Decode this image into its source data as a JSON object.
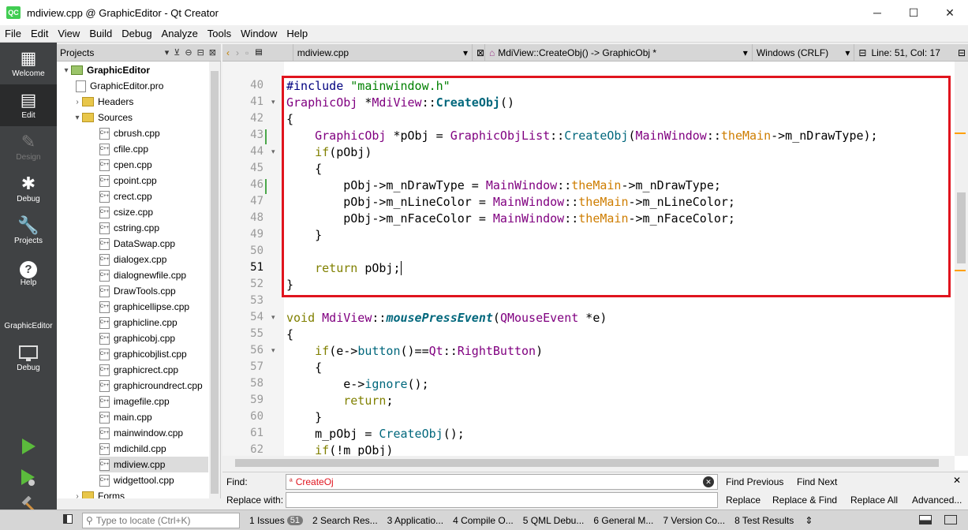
{
  "window": {
    "title": "mdiview.cpp @ GraphicEditor - Qt Creator",
    "app_icon": "QC",
    "controls": [
      "─",
      "☐",
      "✕"
    ]
  },
  "menu": [
    "File",
    "Edit",
    "View",
    "Build",
    "Debug",
    "Analyze",
    "Tools",
    "Window",
    "Help"
  ],
  "modes": [
    {
      "label": "Welcome",
      "icon": "grid-icon",
      "glyph": "▦"
    },
    {
      "label": "Edit",
      "icon": "document-icon",
      "glyph": "▤"
    },
    {
      "label": "Design",
      "icon": "pencil-icon",
      "glyph": "✎"
    },
    {
      "label": "Debug",
      "icon": "bug-icon",
      "glyph": "✱"
    },
    {
      "label": "Projects",
      "icon": "wrench-icon",
      "glyph": "🔧"
    },
    {
      "label": "Help",
      "icon": "help-icon",
      "glyph": "?"
    }
  ],
  "kit": {
    "name": "GraphicEditor",
    "mode": "Debug"
  },
  "projects_pane": {
    "title": "Projects",
    "root": "GraphicEditor",
    "pro_file": "GraphicEditor.pro",
    "headers": "Headers",
    "sources": "Sources",
    "files": [
      "cbrush.cpp",
      "cfile.cpp",
      "cpen.cpp",
      "cpoint.cpp",
      "crect.cpp",
      "csize.cpp",
      "cstring.cpp",
      "DataSwap.cpp",
      "dialogex.cpp",
      "dialognewfile.cpp",
      "DrawTools.cpp",
      "graphicellipse.cpp",
      "graphicline.cpp",
      "graphicobj.cpp",
      "graphicobjlist.cpp",
      "graphicrect.cpp",
      "graphicroundrect.cpp",
      "imagefile.cpp",
      "main.cpp",
      "mainwindow.cpp",
      "mdichild.cpp",
      "mdiview.cpp",
      "widgettool.cpp"
    ],
    "selected": "mdiview.cpp",
    "forms": "Forms"
  },
  "editor_toolbar": {
    "file": "mdiview.cpp",
    "symbol": "MdiView::CreateObj() -> GraphicObj *",
    "line_endings": "Windows (CRLF)",
    "position": "Line: 51, Col: 17"
  },
  "editor": {
    "line_numbers": [
      "40",
      "41",
      "42",
      "43",
      "44",
      "45",
      "46",
      "47",
      "48",
      "49",
      "50",
      "51",
      "52",
      "53",
      "54",
      "55",
      "56",
      "57",
      "58",
      "59",
      "60",
      "61",
      "62"
    ],
    "current_line": "51"
  },
  "find": {
    "find_label": "Find:",
    "replace_label": "Replace with:",
    "find_value": "CreateOj",
    "find_prev": "Find Previous",
    "find_next": "Find Next",
    "replace": "Replace",
    "replace_find": "Replace & Find",
    "replace_all": "Replace All",
    "advanced": "Advanced..."
  },
  "status": {
    "locator_placeholder": "Type to locate (Ctrl+K)",
    "panes": [
      {
        "label": "1  Issues",
        "badge": "51"
      },
      {
        "label": "2  Search Res..."
      },
      {
        "label": "3  Applicatio..."
      },
      {
        "label": "4  Compile O..."
      },
      {
        "label": "5  QML Debu..."
      },
      {
        "label": "6  General M..."
      },
      {
        "label": "7  Version Co..."
      },
      {
        "label": "8  Test Results"
      }
    ]
  }
}
